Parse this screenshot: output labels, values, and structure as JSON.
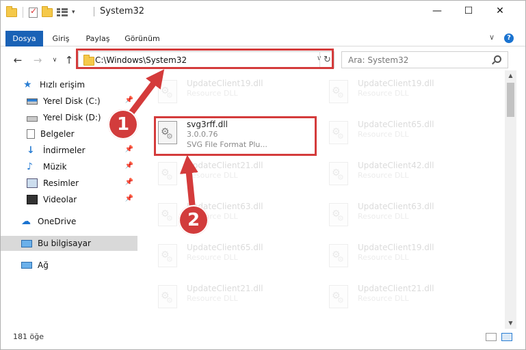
{
  "window": {
    "title": "System32",
    "minimize": "—",
    "maximize": "☐",
    "close": "✕"
  },
  "ribbon": {
    "tabs": [
      {
        "label": "Dosya",
        "active": true
      },
      {
        "label": "Giriş"
      },
      {
        "label": "Paylaş"
      },
      {
        "label": "Görünüm"
      }
    ],
    "collapse_glyph": "∨",
    "help_glyph": "?"
  },
  "nav": {
    "back": "←",
    "forward": "→",
    "recent": "∨",
    "up": "↑",
    "address": "C:\\Windows\\System32",
    "dropdown": "∨",
    "refresh": "↻",
    "search_placeholder": "Ara: System32"
  },
  "sidebar": {
    "items": [
      {
        "label": "Hızlı erişim",
        "icon": "star-icon"
      },
      {
        "label": "Yerel Disk (C:)",
        "icon": "drive-icon",
        "pinned": true
      },
      {
        "label": "Yerel Disk (D:)",
        "icon": "drive-icon"
      },
      {
        "label": "Belgeler",
        "icon": "document-icon",
        "pinned": true
      },
      {
        "label": "İndirmeler",
        "icon": "download-icon",
        "pinned": true
      },
      {
        "label": "Müzik",
        "icon": "music-icon",
        "pinned": true
      },
      {
        "label": "Resimler",
        "icon": "pictures-icon",
        "pinned": true
      },
      {
        "label": "Videolar",
        "icon": "video-icon",
        "pinned": true
      },
      {
        "label": "OneDrive",
        "icon": "cloud-icon"
      },
      {
        "label": "Bu bilgisayar",
        "icon": "computer-icon",
        "selected": true
      },
      {
        "label": "Ağ",
        "icon": "network-icon"
      }
    ],
    "pin_glyph": "📌"
  },
  "files": {
    "highlighted": {
      "name": "svg3rff.dll",
      "version": "3.0.0.76",
      "description": "SVG File Format Plu..."
    },
    "background": [
      {
        "name": "UpdateClient19.dll",
        "type": "Resource DLL"
      },
      {
        "name": "UpdateClient19.dll",
        "type": "Resource DLL"
      },
      {
        "name": "UpdateClient65.dll",
        "type": "Resource DLL"
      },
      {
        "name": "UpdateClient21.dll",
        "type": "Resource DLL"
      },
      {
        "name": "UpdateClient42.dll",
        "type": "Resource DLL"
      },
      {
        "name": "UpdateClient63.dll",
        "type": "Resource DLL"
      },
      {
        "name": "UpdateClient63.dll",
        "type": "Resource DLL"
      },
      {
        "name": "UpdateClient65.dll",
        "type": "Resource DLL"
      },
      {
        "name": "UpdateClient19.dll",
        "type": "Resource DLL"
      },
      {
        "name": "UpdateClient21.dll",
        "type": "Resource DLL"
      },
      {
        "name": "UpdateClient21.dll",
        "type": "Resource DLL"
      }
    ]
  },
  "scroll": {
    "up": "▲",
    "down": "▼"
  },
  "status": {
    "count": "181 öğe"
  },
  "annotations": {
    "step1": "1",
    "step2": "2",
    "color": "#d43b3b"
  }
}
